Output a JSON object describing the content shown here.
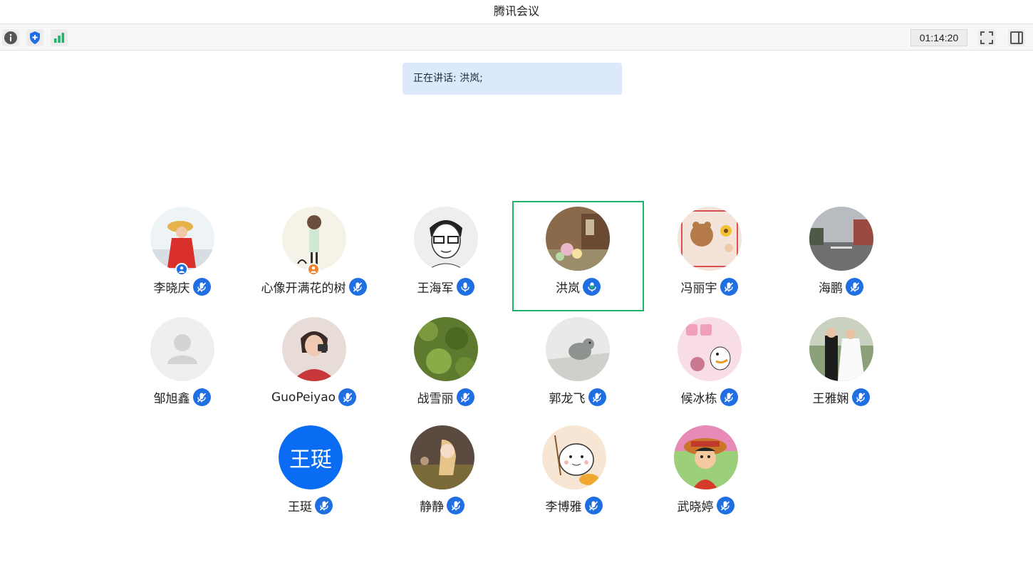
{
  "window": {
    "title": "腾讯会议"
  },
  "toolbar": {
    "timer": "01:14:20",
    "icons": [
      "info-icon",
      "shield-icon",
      "signal-icon",
      "fullscreen-icon",
      "sidebar-toggle-icon"
    ]
  },
  "speaking": {
    "text": "正在讲话: 洪岚;"
  },
  "colors": {
    "accent": "#1f6fe3",
    "active_border": "#1fb36c",
    "speaking_bg": "#dbe9fb",
    "initials_bg": "#0a6cf2"
  },
  "participants": [
    {
      "name": "李晓庆",
      "mic": "muted",
      "role": "host"
    },
    {
      "name": "心像开满花的树",
      "mic": "muted",
      "role": "cohost"
    },
    {
      "name": "王海军",
      "mic": "on"
    },
    {
      "name": "洪岚",
      "mic": "speaking",
      "active": true
    },
    {
      "name": "冯丽宇",
      "mic": "muted"
    },
    {
      "name": "海鹏",
      "mic": "muted"
    },
    {
      "name": "邹旭鑫",
      "mic": "muted"
    },
    {
      "name": "GuoPeiyao",
      "mic": "muted"
    },
    {
      "name": "战雪丽",
      "mic": "muted"
    },
    {
      "name": "郭龙飞",
      "mic": "muted"
    },
    {
      "name": "候冰栋",
      "mic": "muted"
    },
    {
      "name": "王雅娴",
      "mic": "muted"
    },
    {
      "name": "王珽",
      "mic": "muted",
      "initials": "王珽"
    },
    {
      "name": "静静",
      "mic": "muted"
    },
    {
      "name": "李博雅",
      "mic": "muted"
    },
    {
      "name": "武晓婷",
      "mic": "muted"
    }
  ]
}
